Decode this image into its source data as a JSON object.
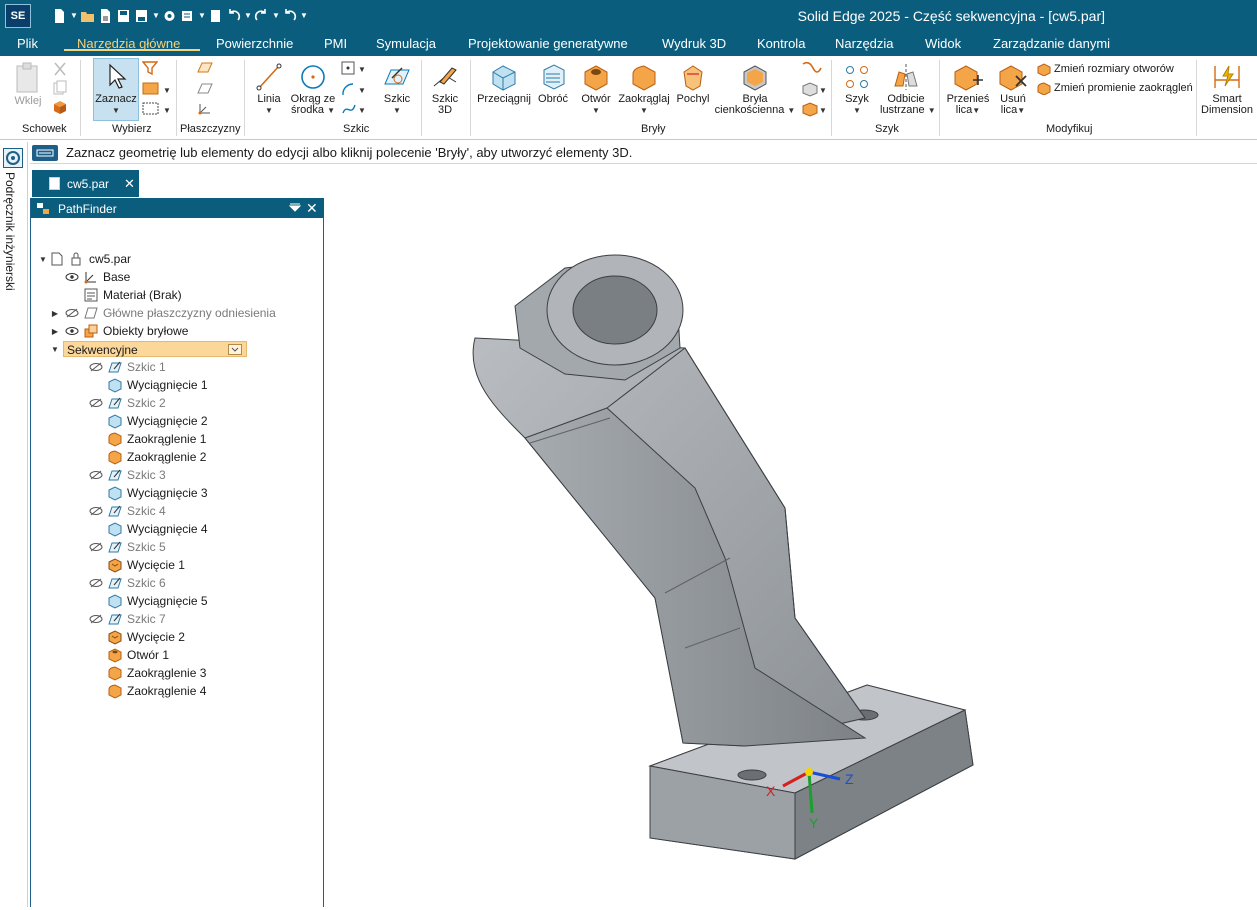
{
  "app": {
    "logo": "SE",
    "window_title": "Solid Edge 2025 - Część sekwencyjna - [cw5.par]"
  },
  "ribbon_tabs": [
    {
      "label": "Plik"
    },
    {
      "label": "Narzędzia główne"
    },
    {
      "label": "Powierzchnie"
    },
    {
      "label": "PMI"
    },
    {
      "label": "Symulacja"
    },
    {
      "label": "Projektowanie generatywne"
    },
    {
      "label": "Wydruk 3D"
    },
    {
      "label": "Kontrola"
    },
    {
      "label": "Narzędzia"
    },
    {
      "label": "Widok"
    },
    {
      "label": "Zarządzanie danymi"
    }
  ],
  "ribbon": {
    "paste": "Wklej",
    "select": "Zaznacz",
    "line": "Linia",
    "circle_line1": "Okrąg ze",
    "circle_line2": "środka",
    "sketch": "Szkic",
    "sketch3d_line1": "Szkic",
    "sketch3d_line2": "3D",
    "extrude": "Przeciągnij",
    "revolve": "Obróć",
    "hole": "Otwór",
    "round": "Zaokrąglaj",
    "draft": "Pochyl",
    "thin_line1": "Bryła",
    "thin_line2": "cienkościenna",
    "pattern": "Szyk",
    "mirror_line1": "Odbicie",
    "mirror_line2": "lustrzane",
    "move_line1": "Przenieś",
    "move_line2": "lica",
    "delete_line1": "Usuń",
    "delete_line2": "lica",
    "resize_holes": "Zmień rozmiary otworów",
    "resize_rounds": "Zmień promienie zaokrągleń",
    "smart_line1": "Smart",
    "smart_line2": "Dimension",
    "groups": {
      "clipboard": "Schowek",
      "select": "Wybierz",
      "planes": "Płaszczyzny",
      "sketch": "Szkic",
      "solids": "Bryły",
      "pattern": "Szyk",
      "modify": "Modyfikuj"
    }
  },
  "command_bar": {
    "prompt": "Zaznacz geometrię lub elementy do edycji albo kliknij polecenie 'Bryły', aby utworzyć elementy 3D."
  },
  "left_bar": {
    "label": "Podręcznik inżynierski"
  },
  "doc_tab": {
    "label": "cw5.par",
    "close": "✕"
  },
  "pathfinder": {
    "title": "PathFinder",
    "close": "✕",
    "root": "cw5.par",
    "items": [
      {
        "label": "Base"
      },
      {
        "label": "Materiał (Brak)"
      },
      {
        "label": "Główne płaszczyzny odniesienia"
      },
      {
        "label": "Obiekty bryłowe"
      },
      {
        "label": "Sekwencyjne"
      },
      {
        "label": "Szkic 1"
      },
      {
        "label": "Wyciągnięcie 1"
      },
      {
        "label": "Szkic 2"
      },
      {
        "label": "Wyciągnięcie 2"
      },
      {
        "label": "Zaokrąglenie 1"
      },
      {
        "label": "Zaokrąglenie 2"
      },
      {
        "label": "Szkic 3"
      },
      {
        "label": "Wyciągnięcie 3"
      },
      {
        "label": "Szkic 4"
      },
      {
        "label": "Wyciągnięcie 4"
      },
      {
        "label": "Szkic 5"
      },
      {
        "label": "Wycięcie 1"
      },
      {
        "label": "Szkic 6"
      },
      {
        "label": "Wyciągnięcie 5"
      },
      {
        "label": "Szkic 7"
      },
      {
        "label": "Wycięcie 2"
      },
      {
        "label": "Otwór 1"
      },
      {
        "label": "Zaokrąglenie 3"
      },
      {
        "label": "Zaokrąglenie 4"
      }
    ]
  },
  "triad": {
    "x": "X",
    "y": "Y",
    "z": "Z"
  },
  "colors": {
    "titlebar": "#0b5d7d",
    "accent_tab": "#f6d27a",
    "model_gray": "#9ea3a8",
    "selection": "#fbd79a"
  }
}
